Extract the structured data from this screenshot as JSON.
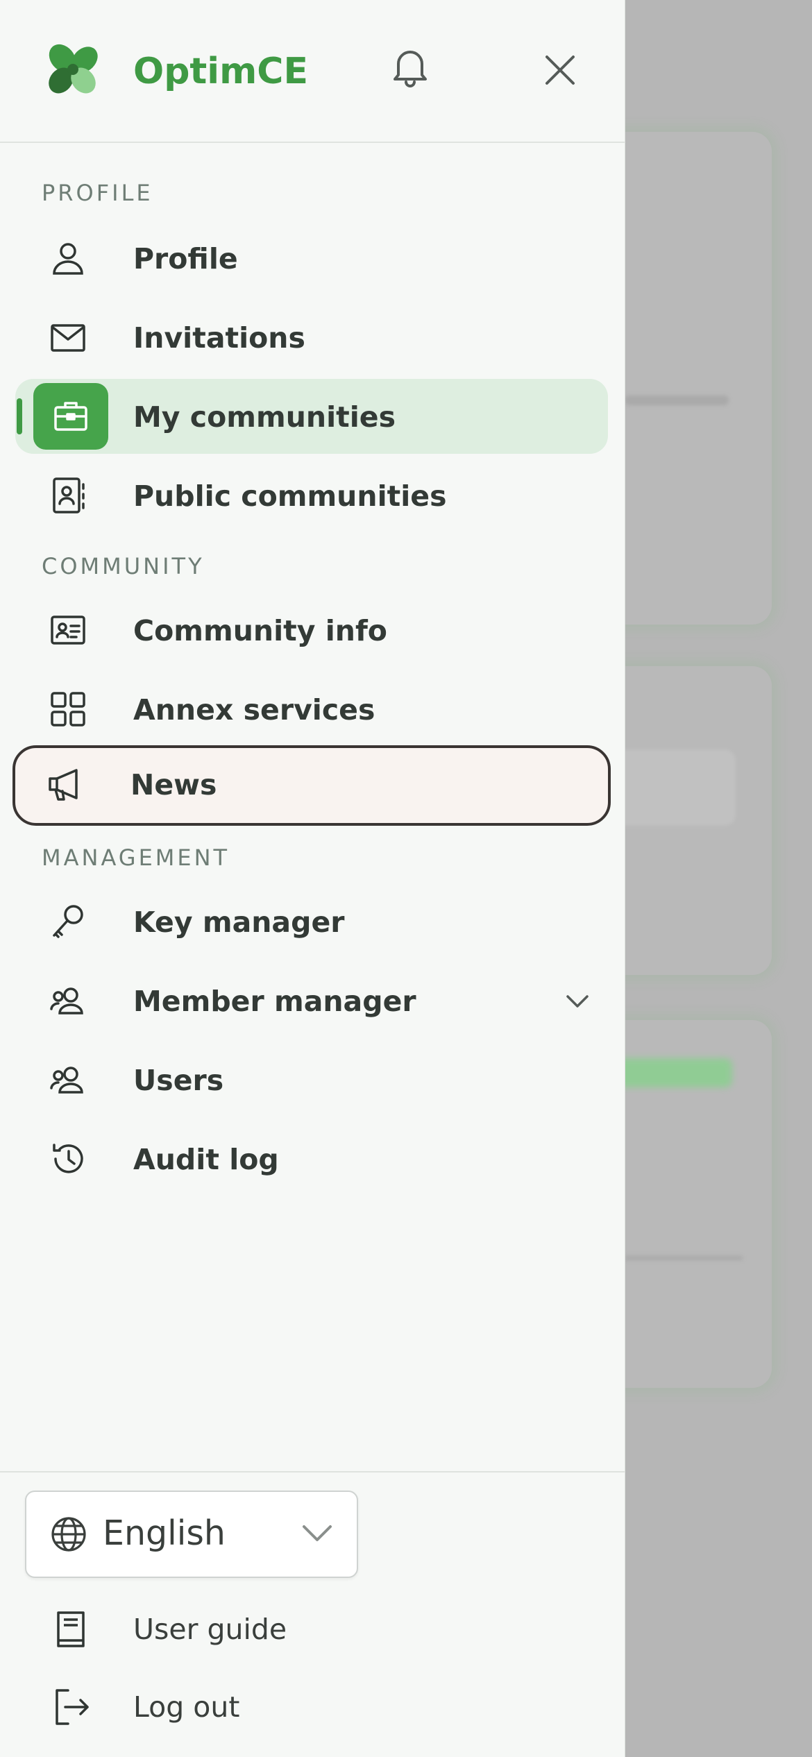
{
  "app": {
    "brand": "OptimCE"
  },
  "colors": {
    "brand_green": "#3f9a44",
    "active_bg": "#deeee0",
    "drawer_bg": "#f6f8f6"
  },
  "header": {
    "logo_icon": "clover-logo-icon",
    "notification_icon": "bell-icon",
    "close_icon": "close-icon"
  },
  "sections": {
    "profile": {
      "title": "PROFILE",
      "items": [
        {
          "label": "Profile",
          "icon": "user-icon"
        },
        {
          "label": "Invitations",
          "icon": "envelope-icon"
        },
        {
          "label": "My communities",
          "icon": "briefcase-icon",
          "active": true
        },
        {
          "label": "Public communities",
          "icon": "contact-book-icon"
        }
      ]
    },
    "community": {
      "title": "COMMUNITY",
      "items": [
        {
          "label": "Community info",
          "icon": "id-card-icon"
        },
        {
          "label": "Annex services",
          "icon": "grid-icon"
        },
        {
          "label": "News",
          "icon": "megaphone-icon",
          "focused": true
        }
      ]
    },
    "management": {
      "title": "MANAGEMENT",
      "items": [
        {
          "label": "Key manager",
          "icon": "key-icon"
        },
        {
          "label": "Member manager",
          "icon": "users-icon",
          "expandable": true
        },
        {
          "label": "Users",
          "icon": "users-icon"
        },
        {
          "label": "Audit log",
          "icon": "history-icon"
        }
      ]
    }
  },
  "footer": {
    "language": {
      "selected": "English",
      "icon": "globe-icon"
    },
    "user_guide": "User guide",
    "logout": "Log out"
  }
}
